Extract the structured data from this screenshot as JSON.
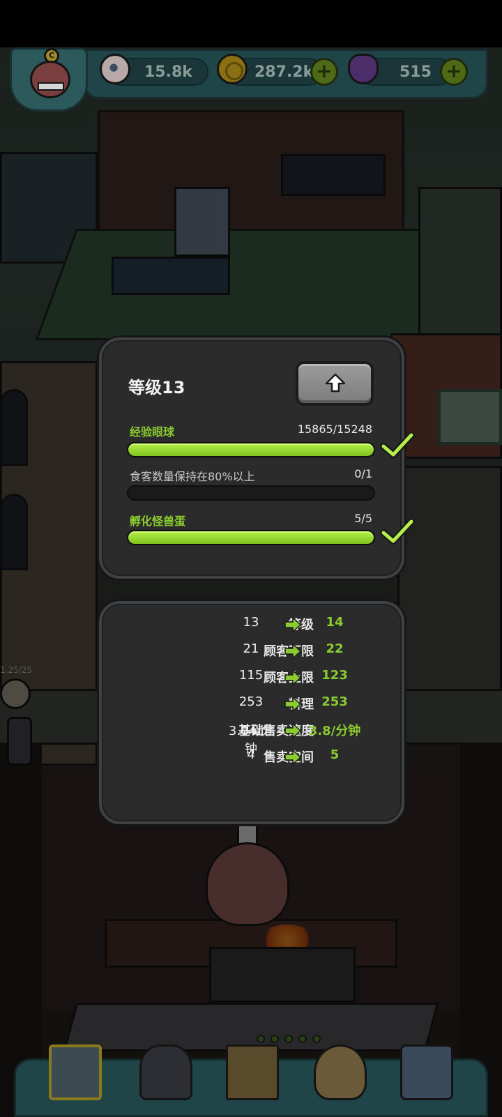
{
  "hud": {
    "avatar_letter": "C",
    "eyeballs": "15.8k",
    "coins": "287.2k",
    "potions": "515",
    "plus_symbol": "+"
  },
  "scene": {
    "npc_label": "1.25/25"
  },
  "level_panel": {
    "title": "等级13",
    "requirements": [
      {
        "label": "经验眼球",
        "value": "15865/15248",
        "progress": 1.0,
        "completed": true
      },
      {
        "label": "食客数量保持在80%以上",
        "value": "0/1",
        "progress": 0.0,
        "completed": false
      },
      {
        "label": "孵化怪兽蛋",
        "value": "5/5",
        "progress": 1.0,
        "completed": true
      }
    ]
  },
  "stats_panel": {
    "rows": [
      {
        "label": "等级",
        "current": "13",
        "next": "14"
      },
      {
        "label": "顾客下限",
        "current": "21",
        "next": "22"
      },
      {
        "label": "顾客上限",
        "current": "115",
        "next": "123"
      },
      {
        "label": "料理",
        "current": "253",
        "next": "253"
      },
      {
        "label": "基础售卖速度",
        "current": "3.04/分钟",
        "next": "3.8/分钟"
      },
      {
        "label": "售卖空间",
        "current": "4",
        "next": "5"
      }
    ]
  },
  "colors": {
    "accent_green": "#8acb2f",
    "progress_green": "#9ee03a",
    "panel_bg": "#2b2b2b",
    "hud_teal": "#1f4548"
  },
  "icons": {
    "hud": [
      "eyeball-icon",
      "coin-icon",
      "potion-icon",
      "plus-icon"
    ],
    "nav": [
      "restaurant-icon",
      "monster-icon",
      "recipe-book-icon",
      "money-bag-icon",
      "monster-collection-icon"
    ],
    "panel": [
      "upgrade-arrow-icon",
      "check-icon",
      "arrow-right-icon"
    ]
  }
}
